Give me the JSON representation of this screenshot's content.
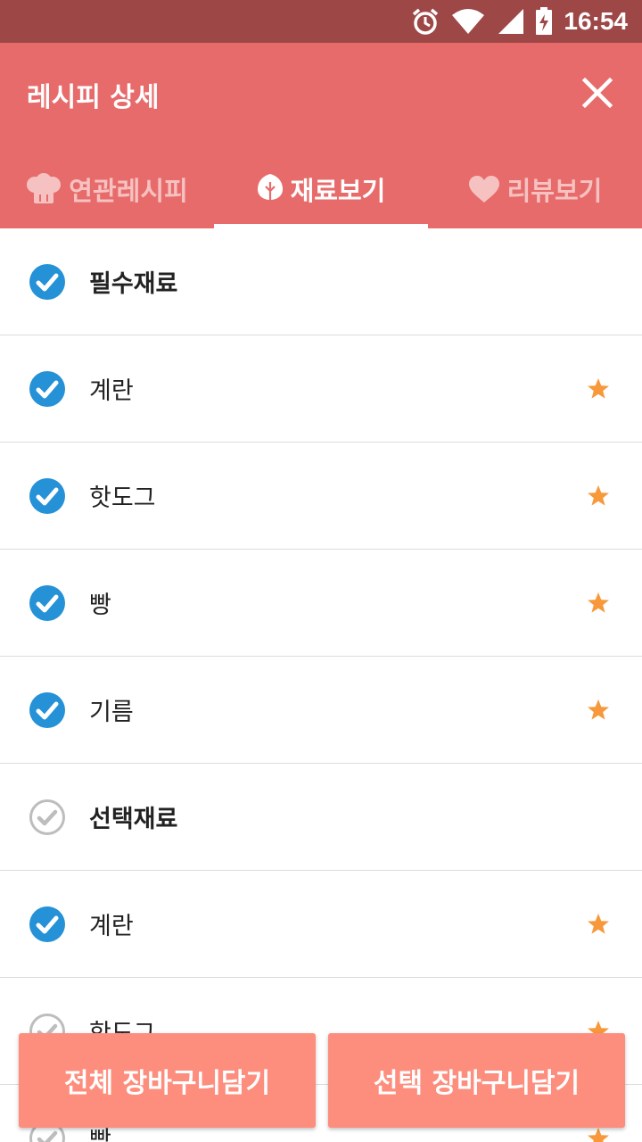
{
  "status_bar": {
    "time": "16:54",
    "icons": [
      "alarm-icon",
      "wifi-icon",
      "signal-icon",
      "battery-charging-icon"
    ]
  },
  "header": {
    "title": "레시피 상세",
    "close_icon": "close-icon"
  },
  "tabs": [
    {
      "label": "연관레시피",
      "icon": "chef-hat-icon",
      "active": false
    },
    {
      "label": "재료보기",
      "icon": "leaf-icon",
      "active": true
    },
    {
      "label": "리뷰보기",
      "icon": "heart-icon",
      "active": false
    }
  ],
  "ingredients": [
    {
      "label": "필수재료",
      "header": true,
      "checked": true,
      "starred": false
    },
    {
      "label": "계란",
      "header": false,
      "checked": true,
      "starred": true
    },
    {
      "label": "핫도그",
      "header": false,
      "checked": true,
      "starred": true
    },
    {
      "label": "빵",
      "header": false,
      "checked": true,
      "starred": true
    },
    {
      "label": "기름",
      "header": false,
      "checked": true,
      "starred": true
    },
    {
      "label": "선택재료",
      "header": true,
      "checked": false,
      "starred": false
    },
    {
      "label": "계란",
      "header": false,
      "checked": true,
      "starred": true
    },
    {
      "label": "핫도그",
      "header": false,
      "checked": false,
      "starred": true
    },
    {
      "label": "빵",
      "header": false,
      "checked": false,
      "starred": true
    }
  ],
  "actions": {
    "add_all": "전체 장바구니담기",
    "add_selected": "선택 장바구니담기"
  },
  "colors": {
    "status_bar": "#9e4747",
    "app_bar": "#e76b6a",
    "check_on": "#2591d6",
    "check_off": "#bdbdbd",
    "star": "#f7983a",
    "button": "#fd8e7e"
  }
}
